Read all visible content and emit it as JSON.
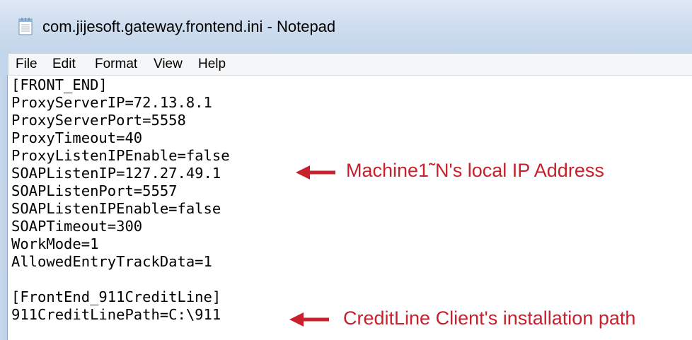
{
  "window": {
    "title": "com.jijesoft.gateway.frontend.ini - Notepad"
  },
  "menu": {
    "items": [
      "File",
      "Edit",
      "Format",
      "View",
      "Help"
    ]
  },
  "editor": {
    "lines": [
      "[FRONT_END]",
      "ProxyServerIP=72.13.8.1",
      "ProxyServerPort=5558",
      "ProxyTimeout=40",
      "ProxyListenIPEnable=false",
      "SOAPListenIP=127.27.49.1",
      "SOAPListenPort=5557",
      "SOAPListenIPEnable=false",
      "SOAPTimeout=300",
      "WorkMode=1",
      "AllowedEntryTrackData=1",
      "",
      "[FrontEnd_911CreditLine]",
      "911CreditLinePath=C:\\911"
    ]
  },
  "annotations": {
    "local_ip": "Machine1˜N's local IP Address",
    "install_path": "CreditLine Client's installation path",
    "color": "#c8202c"
  },
  "icons": {
    "title_icon": "notepad-icon",
    "arrow": "left-arrow-icon"
  }
}
